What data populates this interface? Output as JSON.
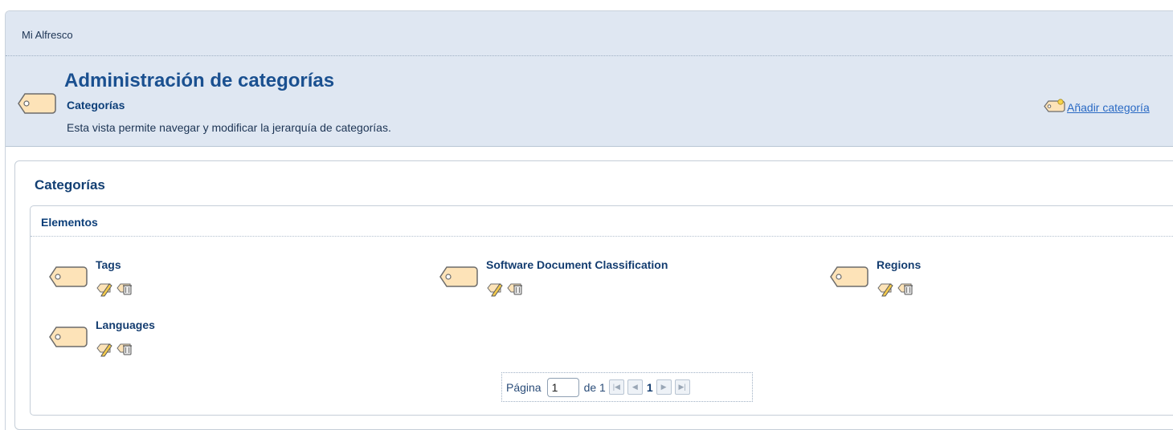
{
  "breadcrumb": "Mi Alfresco",
  "header": {
    "title": "Administración de categorías",
    "subtitle": "Categorías",
    "description": "Esta vista permite navegar y modificar la jerarquía de categorías.",
    "add_link": "Añadir categoría"
  },
  "panel": {
    "title": "Categorías",
    "items_title": "Elementos",
    "items": [
      {
        "label": "Tags"
      },
      {
        "label": "Software Document Classification"
      },
      {
        "label": "Regions"
      },
      {
        "label": "Languages"
      }
    ]
  },
  "pager": {
    "page_label": "Página",
    "page_value": "1",
    "of_label": "de 1",
    "current": "1"
  },
  "colors": {
    "header_bg": "#dfe7f2",
    "title": "#1a5090",
    "link": "#2a6ac4",
    "tag_fill": "#fde3b8",
    "tag_stroke": "#6b6b6b"
  }
}
